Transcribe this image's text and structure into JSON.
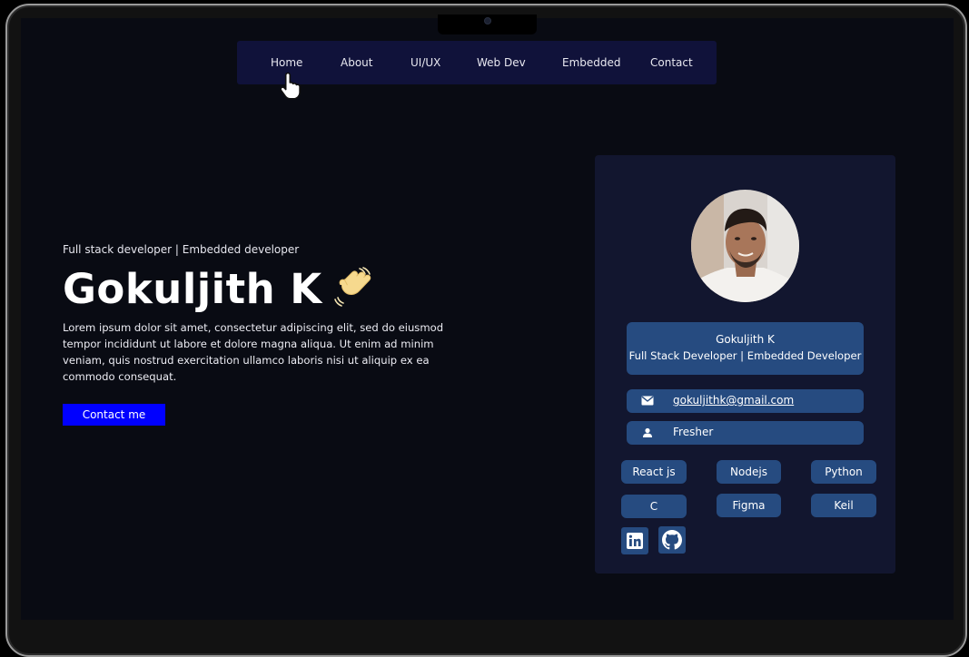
{
  "nav": {
    "items": [
      {
        "label": "Home"
      },
      {
        "label": "About"
      },
      {
        "label": "UI/UX"
      },
      {
        "label": "Web Dev"
      },
      {
        "label": "Embedded"
      },
      {
        "label": "Contact"
      }
    ]
  },
  "hero": {
    "subtitle": "Full stack developer | Embedded developer",
    "name": "Gokuljith K",
    "description": "Lorem ipsum dolor sit amet, consectetur adipiscing elit, sed do eiusmod  tempor incididunt ut labore et dolore magna aliqua. Ut enim ad minim  veniam, quis nostrud exercitation ullamco laboris nisi ut aliquip ex ea  commodo consequat.",
    "cta_label": "Contact me"
  },
  "profile": {
    "name": "Gokuljith K",
    "role": "Full Stack Developer | Embedded Developer",
    "email": "gokuljithk@gmail.com",
    "status": "Fresher",
    "skills": [
      "React js",
      "Nodejs",
      "Python",
      "C",
      "Figma",
      "Keil"
    ],
    "social": [
      "linkedin-icon",
      "github-icon"
    ]
  },
  "colors": {
    "accent": "#0000ff",
    "card_bg": "#12162f",
    "pill_bg": "#264b80",
    "nav_bg": "#10123a",
    "page_bg": "#090b13"
  }
}
